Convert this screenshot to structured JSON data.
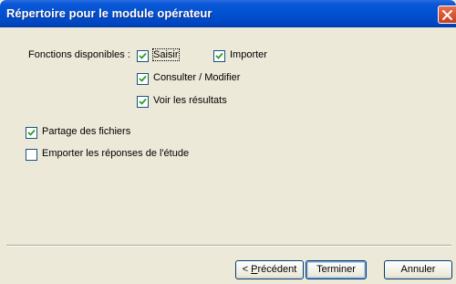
{
  "window": {
    "title": "Répertoire pour le module opérateur",
    "close_icon": "close-icon"
  },
  "functions": {
    "label": "Fonctions disponibles :",
    "saisir": {
      "label": "Saisir",
      "checked": true
    },
    "importer": {
      "label": "Importer",
      "checked": true
    },
    "consulter": {
      "label": "Consulter / Modifier",
      "checked": true
    },
    "voir": {
      "label": "Voir les résultats",
      "checked": true
    }
  },
  "options": {
    "partage": {
      "label": "Partage des fichiers",
      "checked": true
    },
    "emporter": {
      "label": "Emporter les réponses de l'étude",
      "checked": false
    }
  },
  "buttons": {
    "precedent": {
      "prefix": "< ",
      "mnemonic": "P",
      "rest": "récédent"
    },
    "terminer": "Terminer",
    "annuler": "Annuler"
  },
  "colors": {
    "titlebar": "#0050d0",
    "dialog_bg": "#ece9d8",
    "checkbox_border": "#1c5180",
    "checkmark": "#21a121",
    "close_button": "#d8542f"
  }
}
